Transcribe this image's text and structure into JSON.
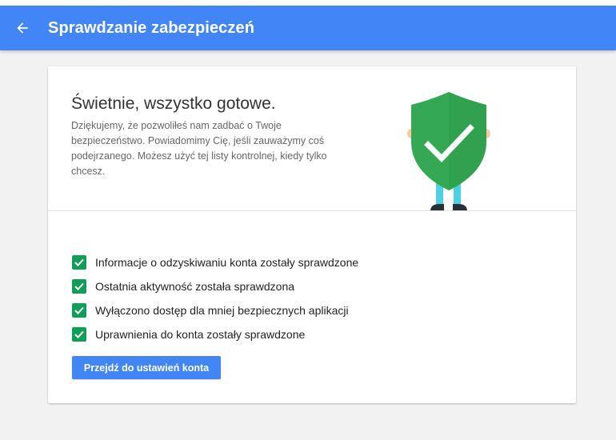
{
  "header": {
    "title": "Sprawdzanie zabezpieczeń",
    "back_icon": "arrow-left-icon",
    "background_color": "#4285f4"
  },
  "hero": {
    "heading": "Świetnie, wszystko gotowe.",
    "description": "Dziękujemy, że pozwoliłeś nam zadbać o Twoje bezpieczeństwo. Powiadomimy Cię, jeśli zauważymy coś podejrzanego. Możesz użyć tej listy kontrolnej, kiedy tylko chcesz.",
    "illustration": "shield-check-character-icon",
    "shield_color": "#34a853"
  },
  "checklist": {
    "items": [
      {
        "label": "Informacje o odzyskiwaniu konta zostały sprawdzone",
        "checked": true
      },
      {
        "label": "Ostatnia aktywność została sprawdzona",
        "checked": true
      },
      {
        "label": "Wyłączono dostęp dla mniej bezpiecznych aplikacji",
        "checked": true
      },
      {
        "label": "Uprawnienia do konta zostały sprawdzone",
        "checked": true
      }
    ],
    "check_color": "#0f9d58"
  },
  "actions": {
    "primary_label": "Przejdź do ustawień konta"
  }
}
